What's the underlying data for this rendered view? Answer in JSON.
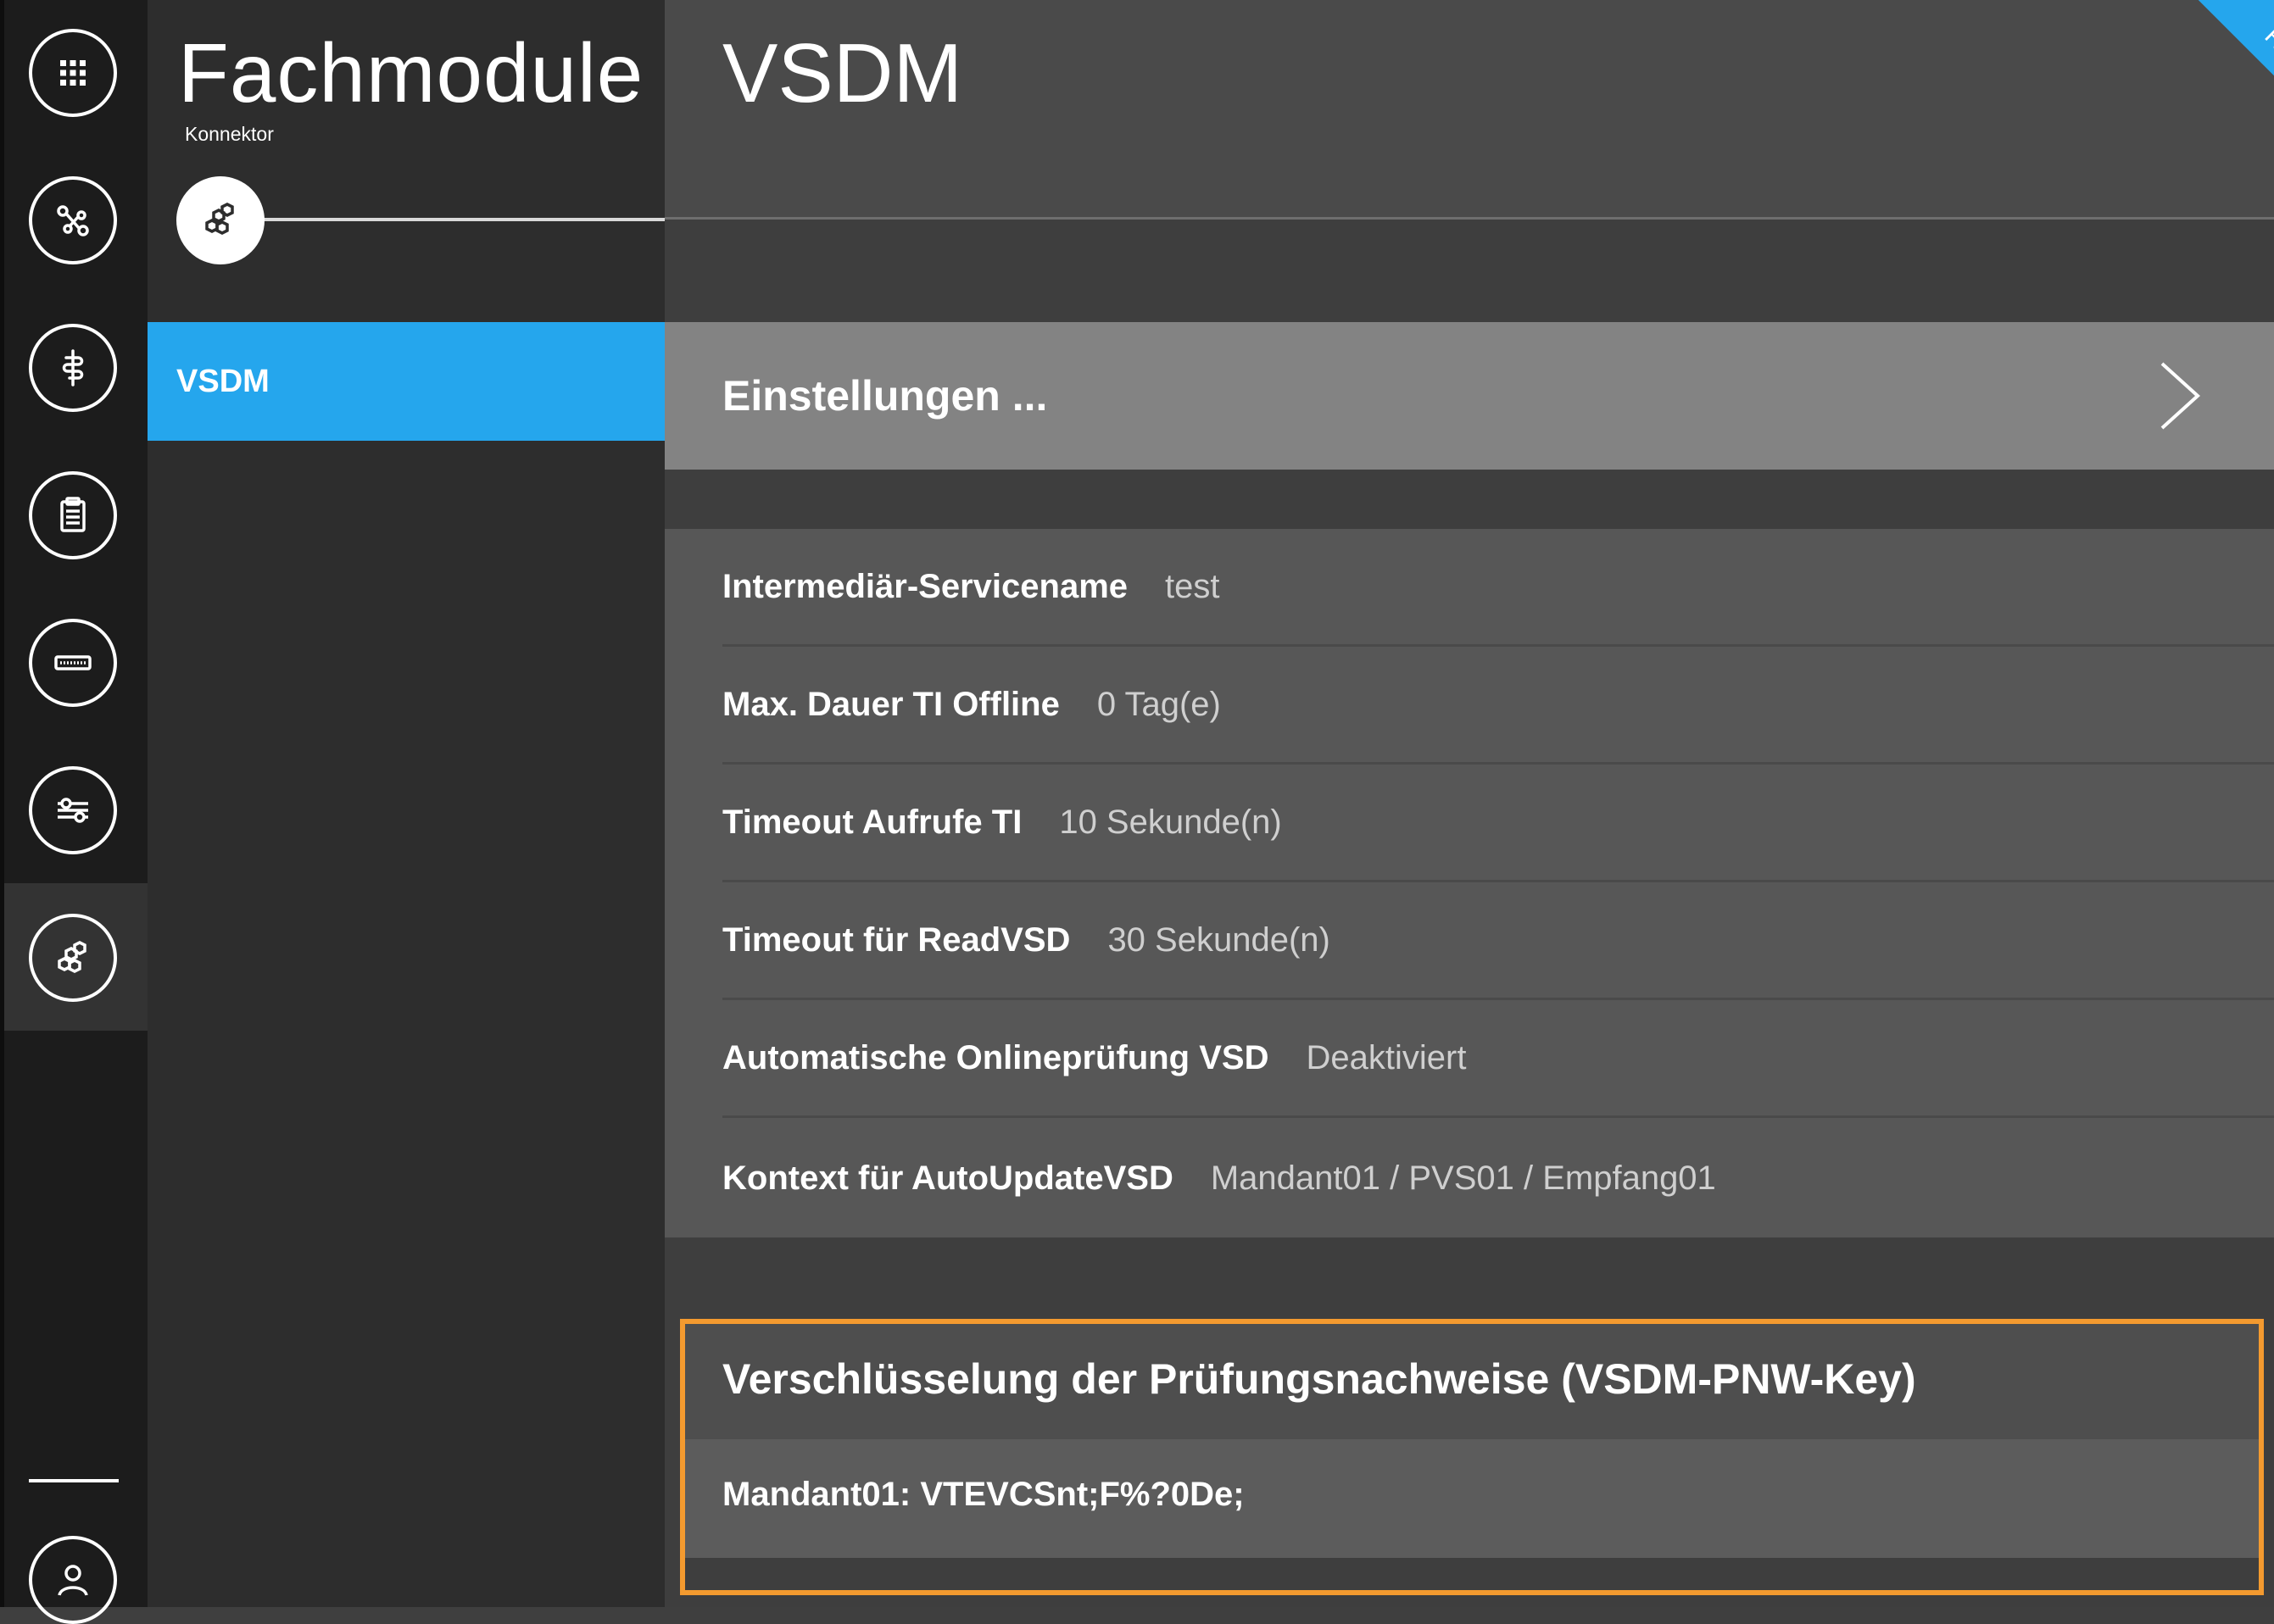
{
  "rail": {
    "items": [
      {
        "icon": "apps-grid-icon"
      },
      {
        "icon": "network-nodes-icon"
      },
      {
        "icon": "medical-caduceus-icon"
      },
      {
        "icon": "clipboard-icon"
      },
      {
        "icon": "card-terminal-icon"
      },
      {
        "icon": "sliders-settings-icon"
      },
      {
        "icon": "hexagon-modules-icon",
        "active": true
      }
    ],
    "bottom_icon": "user-icon"
  },
  "nav": {
    "title": "Fachmodule",
    "subtitle": "Konnektor",
    "badge_icon": "hexagon-modules-icon",
    "items": [
      {
        "label": "VSDM",
        "active": true
      }
    ]
  },
  "main": {
    "title": "VSDM",
    "ribbon": "RU/TU",
    "settings_label": "Einstellungen ...",
    "properties": [
      {
        "label": "Intermediär-Servicename",
        "value": "test"
      },
      {
        "label": "Max. Dauer TI Offline",
        "value": "0 Tag(e)"
      },
      {
        "label": "Timeout Aufrufe TI",
        "value": "10 Sekunde(n)"
      },
      {
        "label": "Timeout für ReadVSD",
        "value": "30 Sekunde(n)"
      },
      {
        "label": "Automatische Onlineprüfung VSD",
        "value": "Deaktiviert"
      },
      {
        "label": "Kontext für AutoUpdateVSD",
        "value": "Mandant01 / PVS01 / Empfang01"
      }
    ],
    "pnw": {
      "title": "Verschlüsselung der Prüfungsnachweise (VSDM-PNW-Key)",
      "entry": "Mandant01: VTEVCSnt;F%?0De;"
    }
  },
  "colors": {
    "accent": "#25a6ed",
    "highlight": "#f39a2f",
    "rail": "#1c1c1c",
    "nav": "#2d2d2d",
    "settings_bar": "#838383"
  }
}
